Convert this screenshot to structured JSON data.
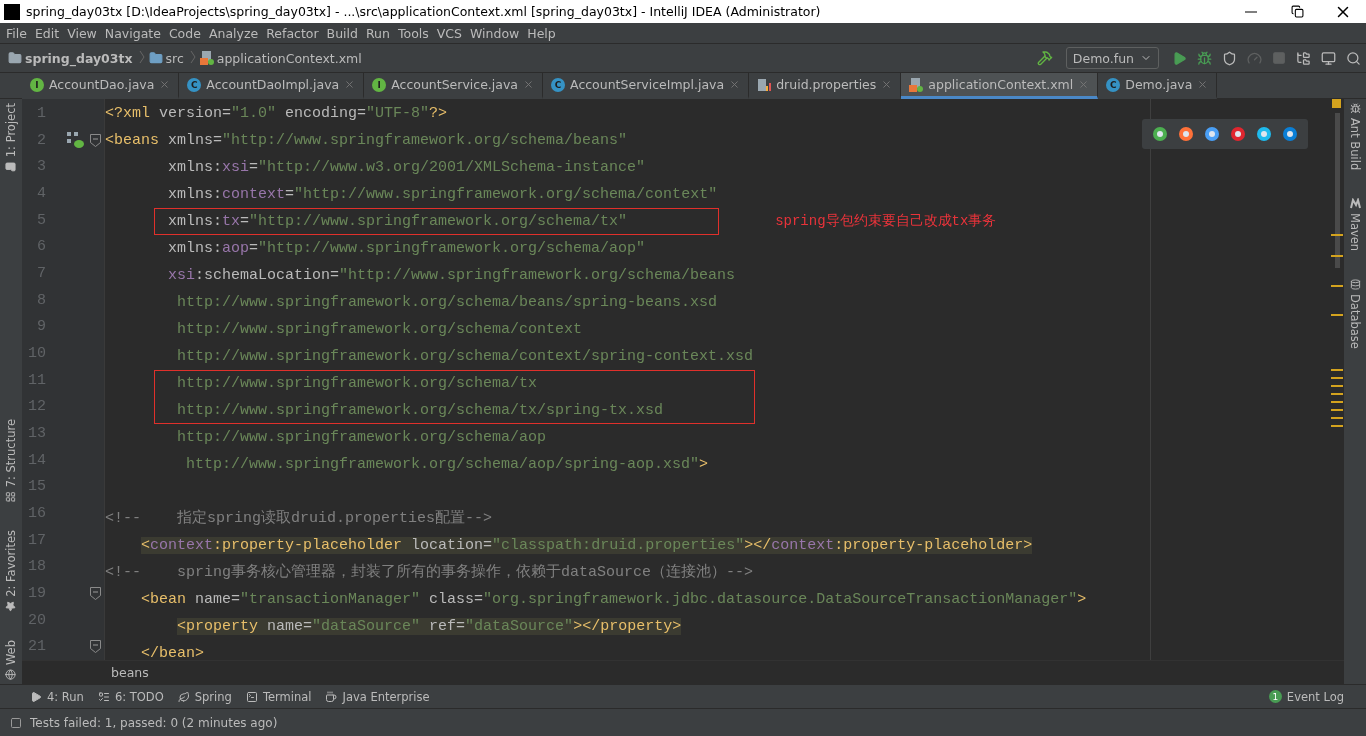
{
  "window": {
    "title": "spring_day03tx [D:\\IdeaProjects\\spring_day03tx] - ...\\src\\applicationContext.xml [spring_day03tx] - IntelliJ IDEA (Administrator)"
  },
  "menu": [
    "File",
    "Edit",
    "View",
    "Navigate",
    "Code",
    "Analyze",
    "Refactor",
    "Build",
    "Run",
    "Tools",
    "VCS",
    "Window",
    "Help"
  ],
  "breadcrumb": [
    {
      "label": "spring_day03tx",
      "kind": "project"
    },
    {
      "label": "src",
      "kind": "folder"
    },
    {
      "label": "applicationContext.xml",
      "kind": "xml"
    }
  ],
  "run_config": {
    "label": "Demo.fun"
  },
  "tabs": [
    {
      "label": "AccountDao.java",
      "kind": "interface",
      "letter": "I",
      "selected": false
    },
    {
      "label": "AccountDaoImpl.java",
      "kind": "class",
      "letter": "C",
      "selected": false
    },
    {
      "label": "AccountService.java",
      "kind": "interface",
      "letter": "I",
      "selected": false
    },
    {
      "label": "AccountServiceImpl.java",
      "kind": "class",
      "letter": "C",
      "selected": false
    },
    {
      "label": "druid.properties",
      "kind": "properties",
      "selected": false
    },
    {
      "label": "applicationContext.xml",
      "kind": "xml",
      "selected": true
    },
    {
      "label": "Demo.java",
      "kind": "class",
      "letter": "C",
      "selected": false
    }
  ],
  "left_tools": [
    {
      "label": "1: Project",
      "kind": "folder"
    },
    {
      "label": "7: Structure",
      "kind": "structure"
    },
    {
      "label": "2: Favorites",
      "kind": "star"
    },
    {
      "label": "Web",
      "kind": "globe"
    }
  ],
  "right_tools": [
    {
      "label": "Ant Build",
      "kind": "ant"
    },
    {
      "label": "Maven",
      "kind": "maven"
    },
    {
      "label": "Database",
      "kind": "database"
    }
  ],
  "lines": [
    {
      "number": "1",
      "tokens": [
        {
          "kind": "tag",
          "text": "<?xml "
        },
        {
          "kind": "attr",
          "text": "version="
        },
        {
          "kind": "value",
          "text": "\"1.0\""
        },
        {
          "kind": "attr",
          "text": " encoding="
        },
        {
          "kind": "value",
          "text": "\"UTF-8\""
        },
        {
          "kind": "tag",
          "text": "?>"
        }
      ]
    },
    {
      "number": "2",
      "fold": true,
      "bean_icon": true,
      "tokens": [
        {
          "kind": "tag",
          "text": "<beans "
        },
        {
          "kind": "attr",
          "text": "xmlns="
        },
        {
          "kind": "value",
          "text": "\"http://www.springframework.org/schema/beans\""
        }
      ]
    },
    {
      "number": "3",
      "tokens": [
        {
          "kind": "attr",
          "text": "       xmlns:"
        },
        {
          "kind": "ns",
          "text": "xsi"
        },
        {
          "kind": "attr",
          "text": "="
        },
        {
          "kind": "value",
          "text": "\"http://www.w3.org/2001/XMLSchema-instance\""
        }
      ]
    },
    {
      "number": "4",
      "tokens": [
        {
          "kind": "attr",
          "text": "       xmlns:"
        },
        {
          "kind": "ns",
          "text": "context"
        },
        {
          "kind": "attr",
          "text": "="
        },
        {
          "kind": "value",
          "text": "\"http://www.springframework.org/schema/context\""
        }
      ]
    },
    {
      "number": "5",
      "boxed": true,
      "note": "spring导包约束要自己改成tx事务",
      "tokens": [
        {
          "kind": "attr",
          "text": "       xmlns:"
        },
        {
          "kind": "ns",
          "text": "tx"
        },
        {
          "kind": "attr",
          "text": "="
        },
        {
          "kind": "value",
          "text": "\"http://www.springframework.org/schema/tx\""
        }
      ]
    },
    {
      "number": "6",
      "tokens": [
        {
          "kind": "attr",
          "text": "       xmlns:"
        },
        {
          "kind": "ns",
          "text": "aop"
        },
        {
          "kind": "attr",
          "text": "="
        },
        {
          "kind": "value",
          "text": "\"http://www.springframework.org/schema/aop\""
        }
      ]
    },
    {
      "number": "7",
      "tokens": [
        {
          "kind": "ns",
          "text": "       xsi"
        },
        {
          "kind": "attr",
          "text": ":schemaLocation="
        },
        {
          "kind": "value",
          "text": "\"http://www.springframework.org/schema/beans"
        }
      ]
    },
    {
      "number": "8",
      "tokens": [
        {
          "kind": "value",
          "text": "        http://www.springframework.org/schema/beans/spring-beans.xsd"
        }
      ]
    },
    {
      "number": "9",
      "tokens": [
        {
          "kind": "value",
          "text": "        http://www.springframework.org/schema/context"
        }
      ]
    },
    {
      "number": "10",
      "tokens": [
        {
          "kind": "value",
          "text": "        http://www.springframework.org/schema/context/spring-context.xsd"
        }
      ]
    },
    {
      "number": "11",
      "boxed": true,
      "tokens": [
        {
          "kind": "value",
          "text": "        http://www.springframework.org/schema/tx"
        }
      ]
    },
    {
      "number": "12",
      "boxed": true,
      "tokens": [
        {
          "kind": "value",
          "text": "        http://www.springframework.org/schema/tx/spring-tx.xsd"
        }
      ]
    },
    {
      "number": "13",
      "tokens": [
        {
          "kind": "value",
          "text": "        http://www.springframework.org/schema/aop"
        }
      ]
    },
    {
      "number": "14",
      "tokens": [
        {
          "kind": "value",
          "text": "         http://www.springframework.org/schema/aop/spring-aop.xsd\""
        },
        {
          "kind": "tag",
          "text": ">"
        }
      ]
    },
    {
      "number": "15"
    },
    {
      "number": "16",
      "tokens": [
        {
          "kind": "comment",
          "text": "<!--    指定spring读取druid.properties配置-->"
        }
      ]
    },
    {
      "number": "17",
      "highlighted": true,
      "tokens": [
        {
          "kind": "tag",
          "text": "    <"
        },
        {
          "kind": "ns",
          "text": "context"
        },
        {
          "kind": "tag",
          "text": ":property-placeholder "
        },
        {
          "kind": "attr",
          "text": "location="
        },
        {
          "kind": "value",
          "text": "\"classpath:druid.properties\""
        },
        {
          "kind": "tag",
          "text": "></"
        },
        {
          "kind": "ns",
          "text": "context"
        },
        {
          "kind": "tag",
          "text": ":property-placeholder>"
        }
      ]
    },
    {
      "number": "18",
      "tokens": [
        {
          "kind": "comment",
          "text": "<!--    spring事务核心管理器，封装了所有的事务操作，依赖于dataSource（连接池）-->"
        }
      ]
    },
    {
      "number": "19",
      "fold": true,
      "tokens": [
        {
          "kind": "tag",
          "text": "    <bean "
        },
        {
          "kind": "attr",
          "text": "name="
        },
        {
          "kind": "value",
          "text": "\"transactionManager\""
        },
        {
          "kind": "attr",
          "text": " class="
        },
        {
          "kind": "value",
          "text": "\"org.springframework.jdbc.datasource.DataSourceTransactionManager\""
        },
        {
          "kind": "tag",
          "text": ">"
        }
      ]
    },
    {
      "number": "20",
      "highlighted": true,
      "tokens": [
        {
          "kind": "tag",
          "text": "        <property "
        },
        {
          "kind": "attr",
          "text": "name="
        },
        {
          "kind": "value",
          "text": "\"dataSource\""
        },
        {
          "kind": "attr",
          "text": " ref="
        },
        {
          "kind": "value",
          "text": "\"dataSource\""
        },
        {
          "kind": "tag",
          "text": "></property>"
        }
      ]
    },
    {
      "number": "21",
      "fold": true,
      "tokens": [
        {
          "kind": "tag",
          "text": "    </bean>"
        }
      ]
    }
  ],
  "editor_breadcrumb": "beans",
  "bottom_tools": [
    {
      "label": "4: Run",
      "kind": "run"
    },
    {
      "label": "6: TODO",
      "kind": "todo"
    },
    {
      "label": "Spring",
      "kind": "spring"
    },
    {
      "label": "Terminal",
      "kind": "terminal"
    },
    {
      "label": "Java Enterprise",
      "kind": "enterprise"
    }
  ],
  "event_log": {
    "label": "Event Log",
    "count": "1"
  },
  "status_bar": {
    "message": "Tests failed: 1, passed: 0 (2 minutes ago)"
  }
}
